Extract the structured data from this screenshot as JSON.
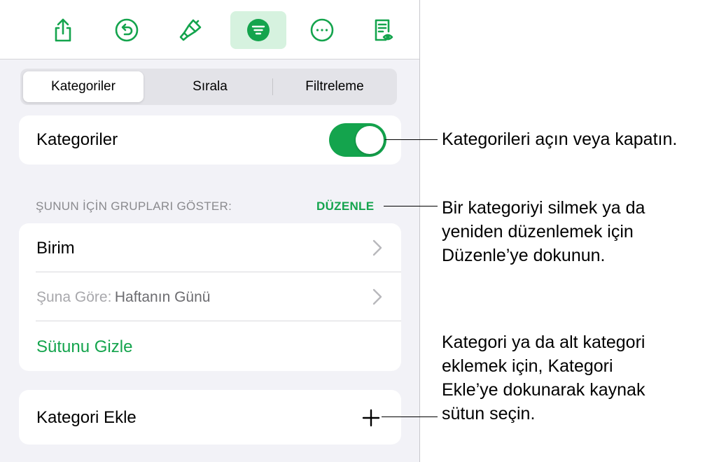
{
  "toolbar": {
    "buttons": [
      {
        "icon": "share-icon"
      },
      {
        "icon": "undo-icon"
      },
      {
        "icon": "paintbrush-icon"
      },
      {
        "icon": "organize-icon",
        "active": true
      },
      {
        "icon": "more-icon"
      },
      {
        "icon": "reading-view-icon"
      }
    ],
    "accent": "#14a44d"
  },
  "tabs": [
    {
      "label": "Kategoriler",
      "selected": true
    },
    {
      "label": "Sırala"
    },
    {
      "label": "Filtreleme"
    }
  ],
  "categories_toggle": {
    "label": "Kategoriler",
    "on": true
  },
  "groups_section": {
    "header": "ŞUNUN İÇİN GRUPLARI GÖSTER:",
    "edit_label": "DÜZENLE"
  },
  "group_rows": {
    "first": {
      "label": "Birim"
    },
    "second": {
      "prefix": "Şuna Göre:",
      "value": "Haftanın Günü"
    },
    "hide_column": "Sütunu Gizle"
  },
  "add_category": {
    "label": "Kategori Ekle",
    "icon": "plus-icon"
  },
  "callouts": {
    "toggle": [
      "Kategorileri açın veya kapatın."
    ],
    "edit": [
      "Bir kategoriyi silmek ya da",
      "yeniden düzenlemek için",
      "Düzenle’ye dokunun."
    ],
    "add": [
      "Kategori ya da alt kategori",
      "eklemek için, Kategori",
      "Ekle’ye dokunarak kaynak",
      "sütun seçin."
    ]
  }
}
